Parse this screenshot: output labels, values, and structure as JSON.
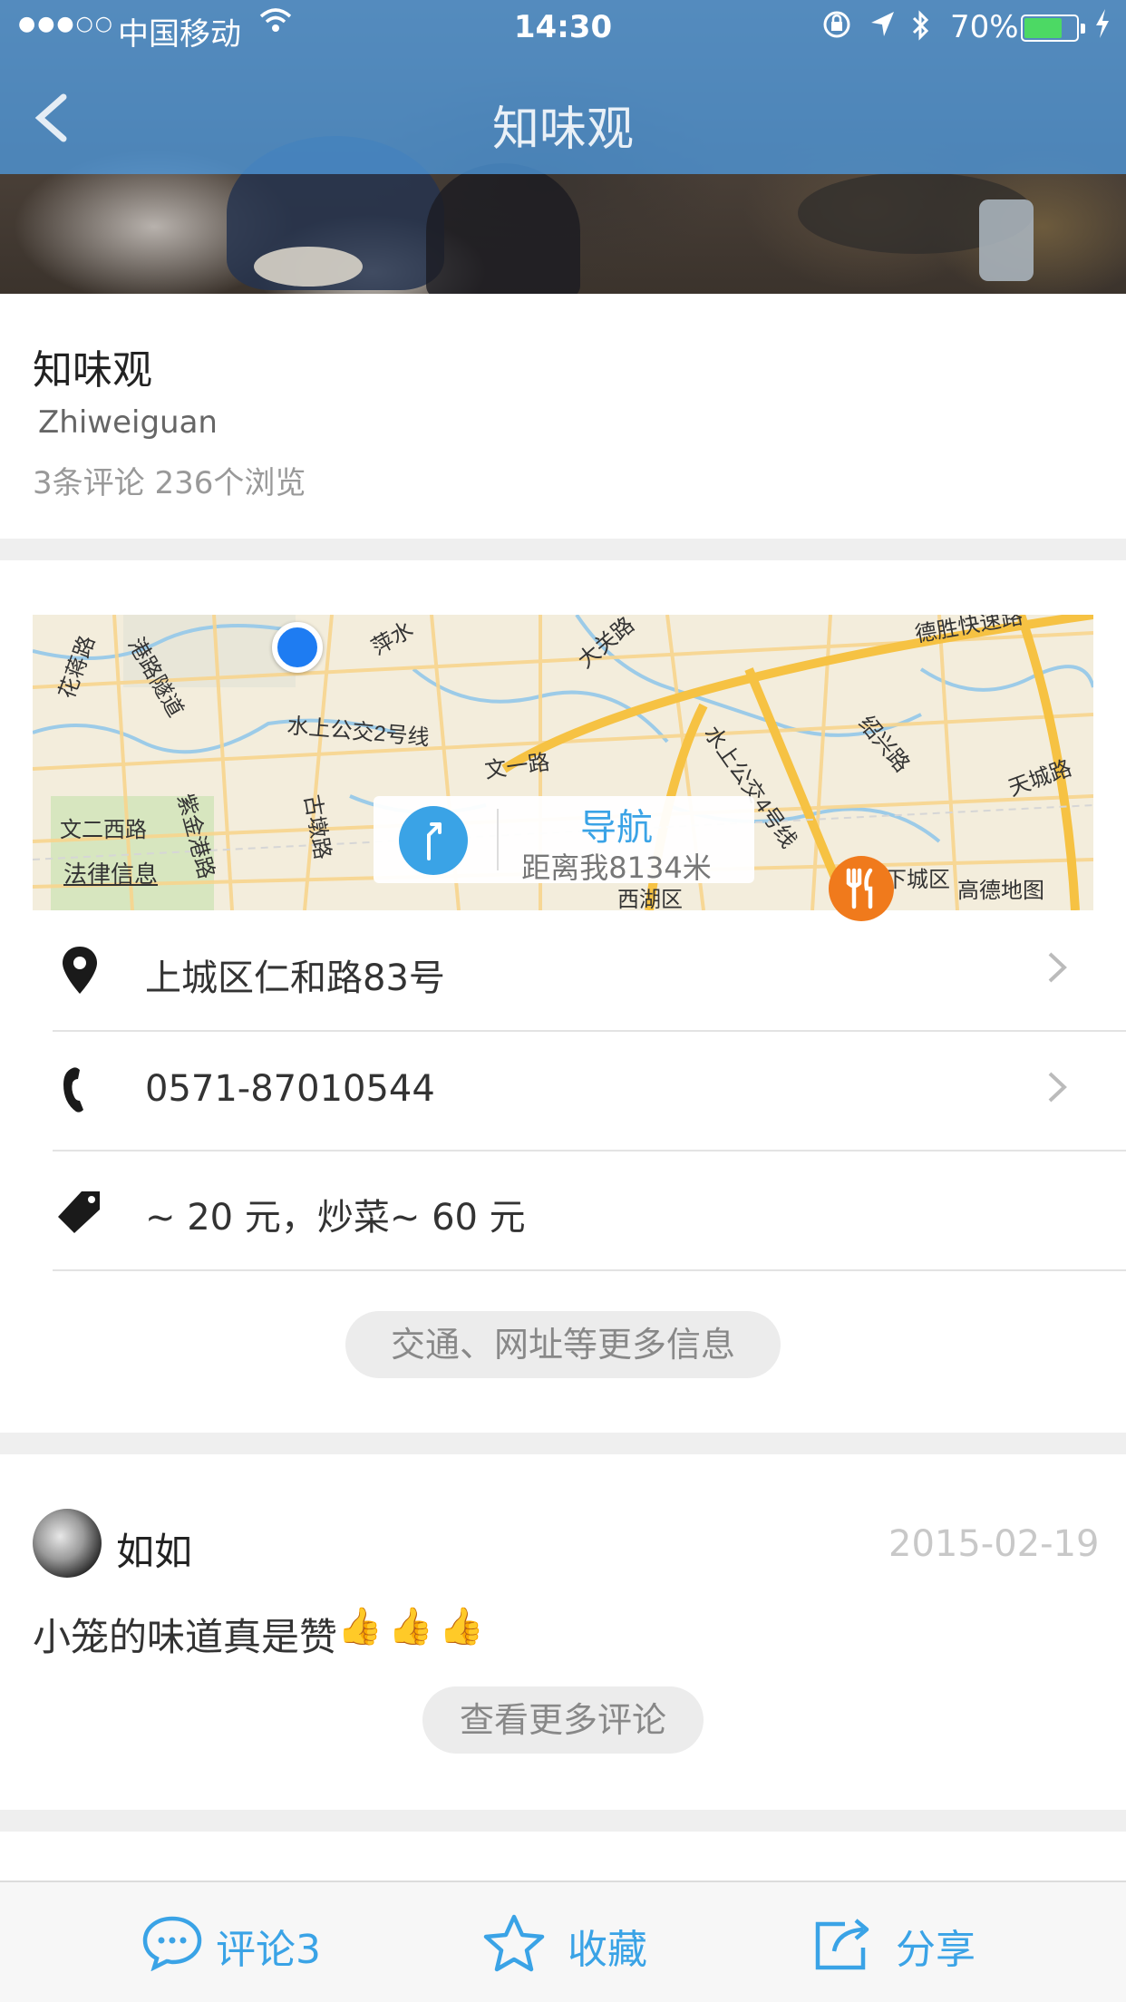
{
  "status_bar": {
    "signal": "●●●○○",
    "carrier": "中国移动",
    "time": "14:30",
    "battery_percent": "70%",
    "battery_level": 0.7
  },
  "nav": {
    "title": "知味观"
  },
  "restaurant": {
    "name": "知味观",
    "pinyin": "Zhiweiguan",
    "stats": "3条评论  236个浏览"
  },
  "map": {
    "nav_label": "导航",
    "distance": "距离我8134米",
    "legal": "法律信息",
    "labels": [
      "花蒋路",
      "港路隧道",
      "水上公交2号线",
      "文一路",
      "紫金港路",
      "古墩路",
      "文二西路",
      "德胜快速路",
      "大关路",
      "绍兴路",
      "水上公交4号线",
      "天城路",
      "西湖区",
      "下城区",
      "高德地图",
      "萍水"
    ]
  },
  "info_rows": [
    {
      "icon": "location-pin-icon",
      "text": "上城区仁和路83号",
      "chevron": true
    },
    {
      "icon": "phone-icon",
      "text": "0571-87010544",
      "chevron": true
    },
    {
      "icon": "price-tag-icon",
      "text": "~ 20 元，炒菜~ 60 元",
      "chevron": false
    }
  ],
  "more_info_button": "交通、网址等更多信息",
  "review": {
    "author": "如如",
    "date": "2015-02-19",
    "text": "小笼的味道真是赞",
    "thumbs": [
      "👍",
      "👍",
      "👍"
    ]
  },
  "more_reviews_button": "查看更多评论",
  "toolbar": {
    "comment_label": "评论3",
    "favorite_label": "收藏",
    "share_label": "分享"
  },
  "colors": {
    "accent": "#3aa3e6",
    "nav_bar": "#4e98dc",
    "user_dot": "#1e7cf2",
    "poi": "#f07a1c",
    "battery": "#4cd964"
  }
}
